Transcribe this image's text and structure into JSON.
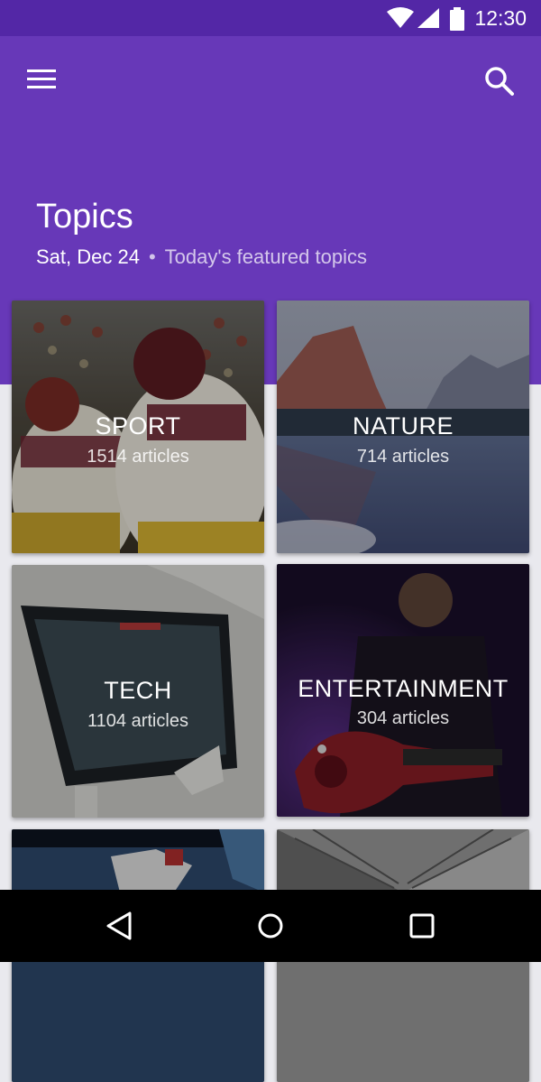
{
  "status_bar": {
    "time": "12:30",
    "icons": [
      "wifi-icon",
      "signal-icon",
      "battery-icon"
    ]
  },
  "app_bar": {
    "menu_icon": "menu-icon",
    "search_icon": "search-icon",
    "title": "Topics",
    "date": "Sat, Dec 24",
    "separator": "•",
    "subtitle": "Today's featured topics"
  },
  "topics": [
    {
      "name": "SPORT",
      "count": "1514 articles"
    },
    {
      "name": "NATURE",
      "count": "714 articles"
    },
    {
      "name": "TECH",
      "count": "1104 articles"
    },
    {
      "name": "ENTERTAINMENT",
      "count": "304 articles"
    }
  ],
  "nav_bar": {
    "icons": [
      "back-icon",
      "home-icon",
      "recents-icon"
    ]
  },
  "colors": {
    "primary": "#6738b8",
    "primary_dark": "#5327a6",
    "background": "#e9e9ee"
  }
}
